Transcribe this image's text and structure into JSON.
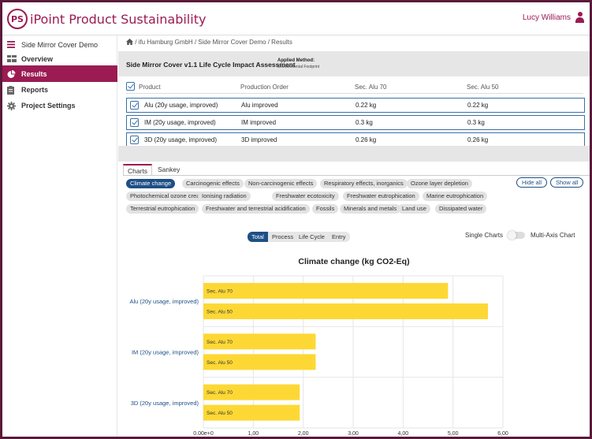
{
  "app": {
    "logo_initials": "PS",
    "title": "iPoint Product Sustainability",
    "user": "Lucy Williams"
  },
  "sidebar": {
    "project": "Side Mirror Cover Demo",
    "items": [
      {
        "label": "Overview",
        "icon": "overview-icon"
      },
      {
        "label": "Results",
        "icon": "pie-chart-icon",
        "active": true
      },
      {
        "label": "Reports",
        "icon": "report-icon"
      },
      {
        "label": "Project Settings",
        "icon": "gear-icon"
      }
    ]
  },
  "breadcrumb": "/ ifu Hamburg GmbH / Side Mirror Cover Demo / Results",
  "assessment": {
    "title": "Side Mirror Cover v1.1 Life Cycle Impact Assessment",
    "method_label": "Applied Method:",
    "method_value": "Environmental Footprint"
  },
  "table": {
    "headers": [
      "Product",
      "Production Order",
      "Sec. Alu 70",
      "Sec. Alu 50"
    ],
    "rows": [
      [
        "Alu (20y usage, improved)",
        "Alu improved",
        "0.22 kg",
        "0.22 kg"
      ],
      [
        "IM (20y usage, improved)",
        "IM improved",
        "0.3 kg",
        "0.3 kg"
      ],
      [
        "3D (20y usage, improved)",
        "3D improved",
        "0.26 kg",
        "0.26 kg"
      ]
    ]
  },
  "tabs": [
    "Charts",
    "Sankey"
  ],
  "categories": [
    "Climate change",
    "Carcinogenic effects",
    "Non-carcinogenic effects",
    "Respiratory effects, inorganics",
    "Ozone layer depletion",
    "Photochemical ozone creation",
    "Ionising radiation",
    "Freshwater ecotoxicity",
    "Freshwater eutrophication",
    "Marine eutrophication",
    "Terrestrial eutrophication",
    "Freshwater and terrestrial acidification",
    "Fossils",
    "Minerals and metals",
    "Land use",
    "Dissipated water"
  ],
  "buttons": {
    "hide_all": "Hide all",
    "show_all": "Show all"
  },
  "view_modes": [
    "Total",
    "Process",
    "Life Cycle",
    "Entry"
  ],
  "toggle": {
    "left": "Single Charts",
    "right": "Multi-Axis Chart"
  },
  "colors": {
    "brand": "#9b1b53",
    "accent": "#1e4f86",
    "bar": "#fdd835"
  },
  "chart_data": {
    "type": "bar",
    "orientation": "horizontal",
    "title": "Climate change (kg CO2-Eq)",
    "categories": [
      "Alu (20y usage, improved)",
      "IM (20y usage, improved)",
      "3D (20y usage, improved)"
    ],
    "series": [
      {
        "name": "Sec. Alu 70",
        "values": [
          4.9,
          2.25,
          1.93
        ]
      },
      {
        "name": "Sec. Alu 50",
        "values": [
          5.7,
          2.25,
          1.93
        ]
      }
    ],
    "xlim": [
      0,
      6
    ],
    "xticks": [
      "0.00e+0",
      "1,00",
      "2,00",
      "3,00",
      "4,00",
      "5,00",
      "6,00"
    ],
    "grid": true
  }
}
